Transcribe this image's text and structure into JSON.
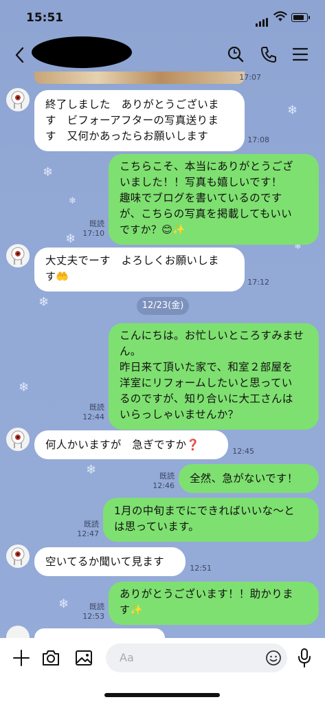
{
  "status_bar": {
    "time": "15:51"
  },
  "header": {
    "icons": [
      "back-icon",
      "search-icon",
      "phone-icon",
      "menu-icon"
    ]
  },
  "messages": [
    {
      "side": "in",
      "lines": [
        "終了しました　ありがとうございま",
        "す　ビフォーアフターの写真送りま",
        "す　又何かあったらお願いします"
      ],
      "time": "17:08"
    },
    {
      "side": "out",
      "lines": [
        "こちらこそ、本当にありがとうござ",
        "いました！！写真も嬉しいです！",
        "趣味でブログを書いているのです",
        "が、こちらの写真を掲載してもいい",
        "ですか？😊✨"
      ],
      "read": "既読",
      "time": "17:10"
    },
    {
      "side": "in",
      "lines": [
        "大丈夫でーす　よろしくお願いしま",
        "す🤲"
      ],
      "time": "17:12"
    },
    {
      "side": "out",
      "lines": [
        "こんにちは。お忙しいところすみませ",
        "ん。",
        "昨日来て頂いた家で、和室２部屋を",
        "洋室にリフォームしたいと思ってい",
        "るのですが、知り合いに大工さんは",
        "いらっしゃいませんか？"
      ],
      "read": "既読",
      "time": "12:44"
    },
    {
      "side": "in",
      "lines": [
        "何人かいますが　急ぎですか❓"
      ],
      "time": "12:45"
    },
    {
      "side": "out",
      "lines": [
        "全然、急がないです！"
      ],
      "read": "既読",
      "time": "12:46"
    },
    {
      "side": "out",
      "lines": [
        "1月の中旬までにできればいいな〜と",
        "は思っています。"
      ],
      "read": "既読",
      "time": "12:47"
    },
    {
      "side": "in",
      "lines": [
        "空いてるか聞いて見ます"
      ],
      "time": "12:51"
    },
    {
      "side": "out",
      "lines": [
        "ありがとうございます！！助かりま",
        "す✨"
      ],
      "read": "既読",
      "time": "12:53"
    }
  ],
  "photo_time": "17:07",
  "date_separator": "12/23(金)",
  "composer": {
    "placeholder": "Aa"
  },
  "colors": {
    "background": "#8fa6d4",
    "outgoing_bubble": "#7ee070",
    "incoming_bubble": "#ffffff"
  }
}
